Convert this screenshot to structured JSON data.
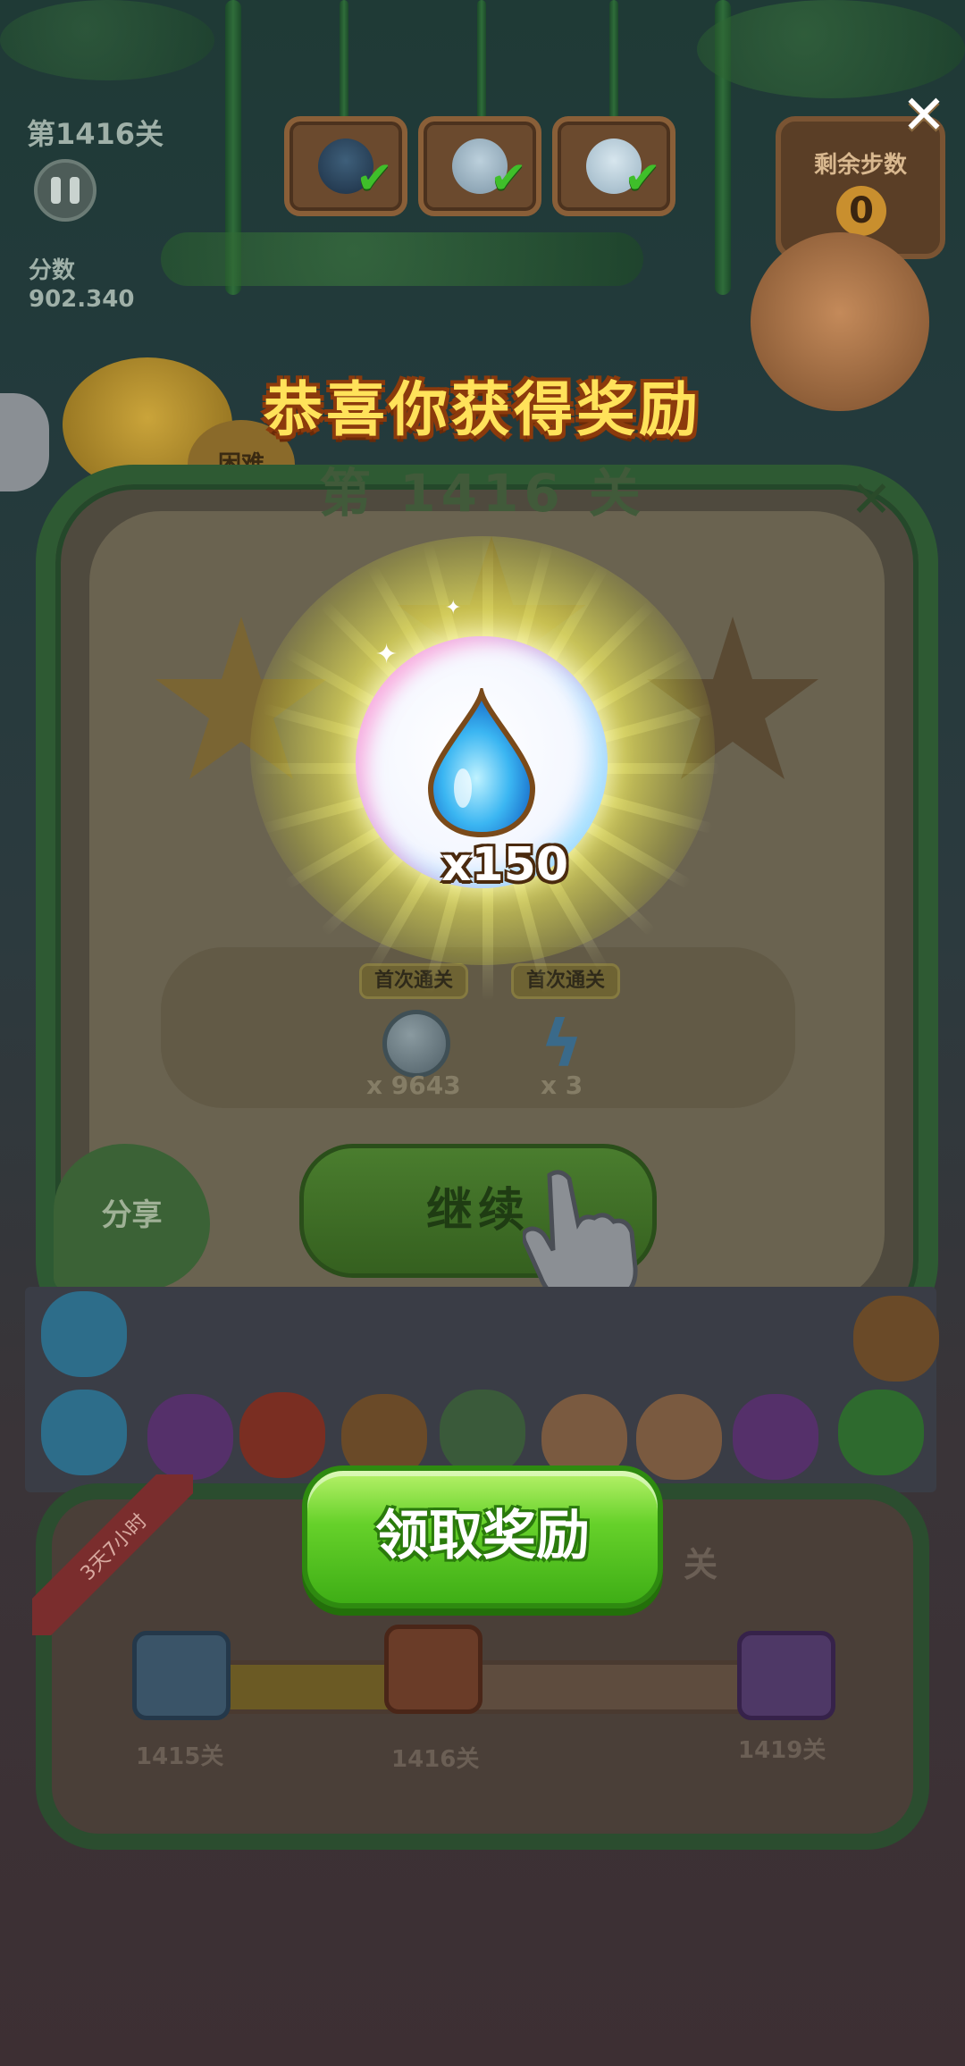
{
  "hud": {
    "level_label": "第1416关",
    "score_label": "分数",
    "score_value": "902.340",
    "steps_label": "剩余步数",
    "steps_value": "0",
    "hard_badge": "困难"
  },
  "targets": [
    {
      "icon": "penguin-icon",
      "done": true
    },
    {
      "icon": "seal-icon",
      "done": true
    },
    {
      "icon": "polar-bear-icon",
      "done": true
    }
  ],
  "result_panel": {
    "level_title": "第 1416 关",
    "first_pass_badges": [
      "首次通关",
      "首次通关"
    ],
    "rewards": [
      {
        "icon": "coin-icon",
        "count": "x 9643"
      },
      {
        "icon": "lightning-icon",
        "count": "x 3"
      }
    ],
    "continue_label": "继续",
    "share_label": "分享"
  },
  "progress_panel": {
    "timer_ribbon": "3天7小时",
    "milestones": [
      {
        "icon": "blue-chest-icon",
        "label": "1415关"
      },
      {
        "icon": "red-chest-icon",
        "label": "1416关"
      },
      {
        "icon": "purple-chest-icon",
        "label": "1419关"
      }
    ],
    "progress_fraction": 0.33,
    "partial_level_suffix": "关"
  },
  "reward_popup": {
    "title": "恭喜你获得奖励",
    "item_icon": "water-drop-icon",
    "quantity": "x150",
    "claim_label": "领取奖励"
  },
  "colors": {
    "claim_green": "#4fc21c",
    "title_yellow": "#ffe25a",
    "title_outline": "#8b3a0c"
  }
}
